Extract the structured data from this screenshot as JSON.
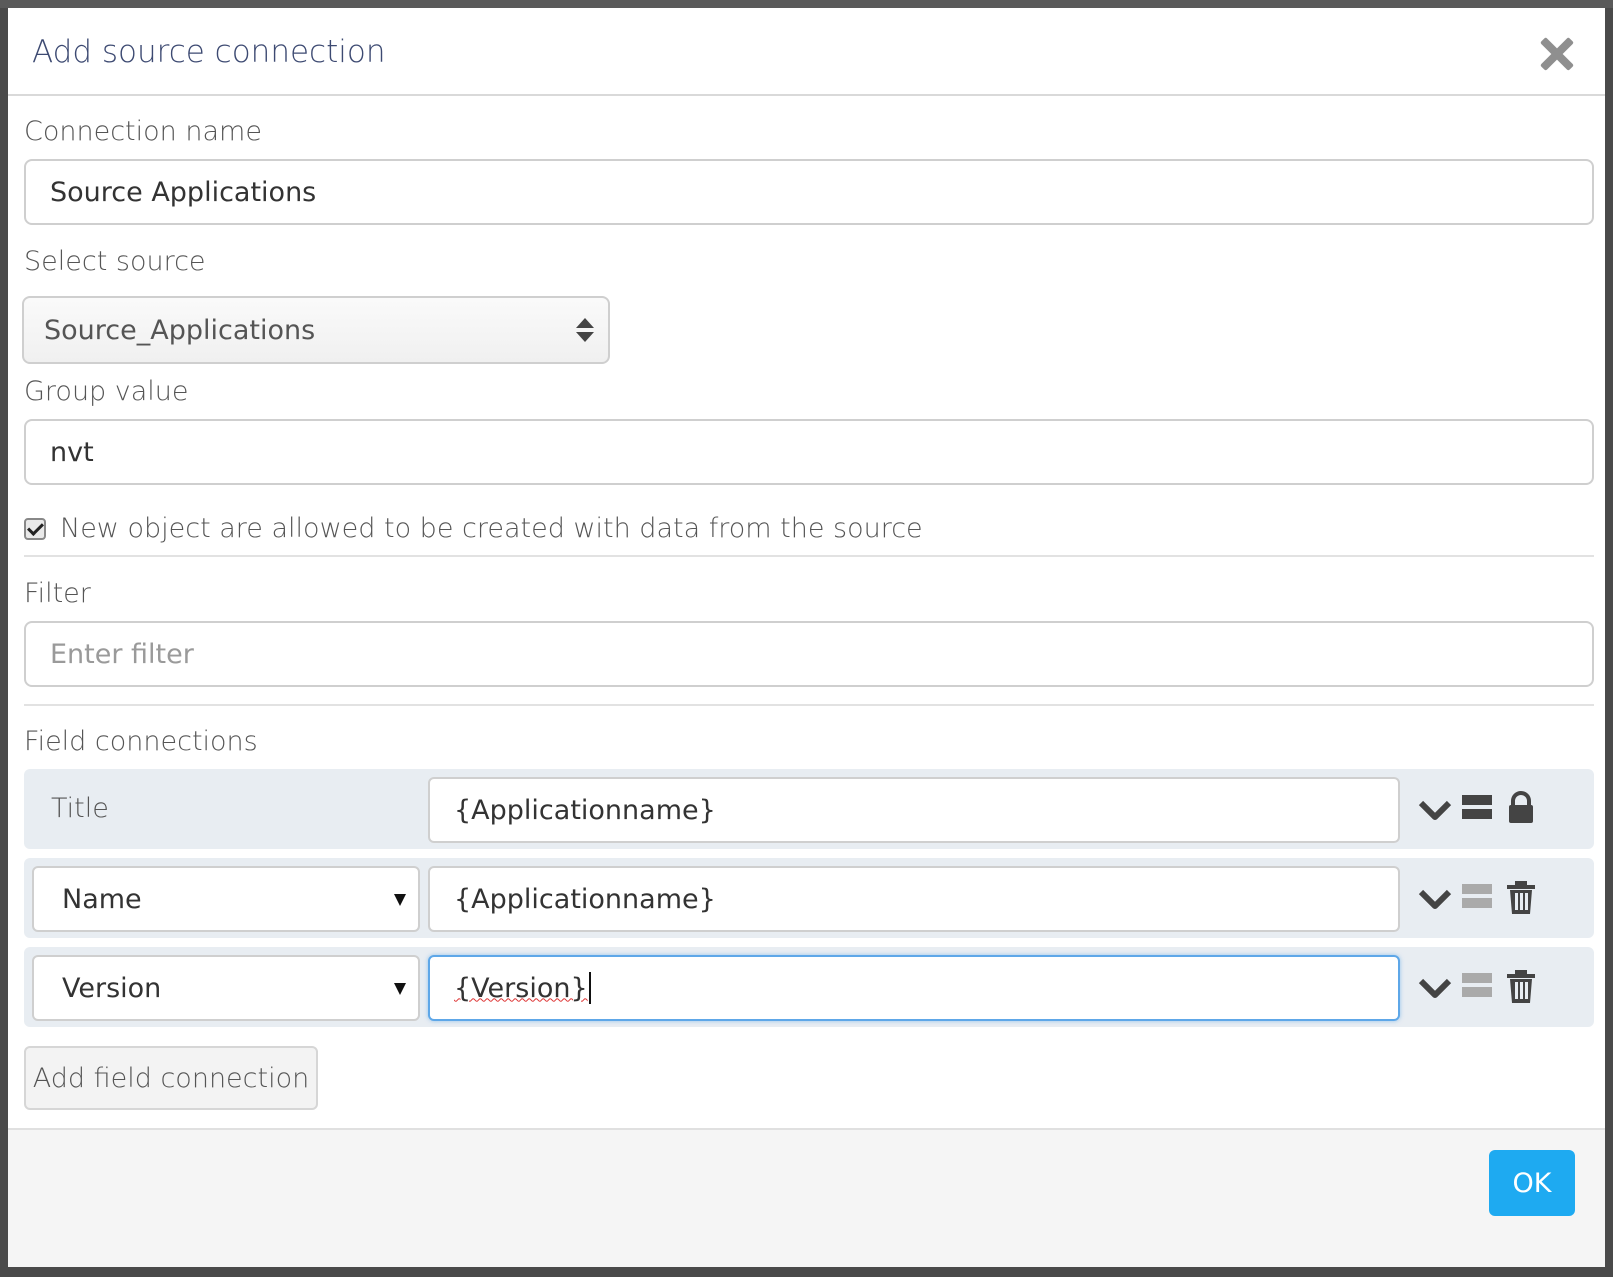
{
  "dialog": {
    "title": "Add source connection",
    "close_icon": "close-icon"
  },
  "connection_name": {
    "label": "Connection name",
    "value": "Source Applications"
  },
  "select_source": {
    "label": "Select source",
    "value": "Source_Applications"
  },
  "group_value": {
    "label": "Group value",
    "value": "nvt"
  },
  "allow_new_objects": {
    "checked": true,
    "label": "New object are allowed to be created with data from the source"
  },
  "filter": {
    "label": "Filter",
    "value": "",
    "placeholder": "Enter filter"
  },
  "field_connections": {
    "label": "Field connections",
    "rows": [
      {
        "field": "Title",
        "value": "{Applicationname}",
        "locked": true
      },
      {
        "field": "Name",
        "value": "{Applicationname}",
        "locked": false
      },
      {
        "field": "Version",
        "value": "{Version}",
        "locked": false,
        "focused": true
      }
    ],
    "add_label": "Add field connection"
  },
  "footer": {
    "ok_label": "OK"
  },
  "colors": {
    "title": "#3d4a72",
    "ok_button": "#1eaaf1",
    "row_background": "#e8edf2",
    "focus_border": "#5ea7e8"
  }
}
